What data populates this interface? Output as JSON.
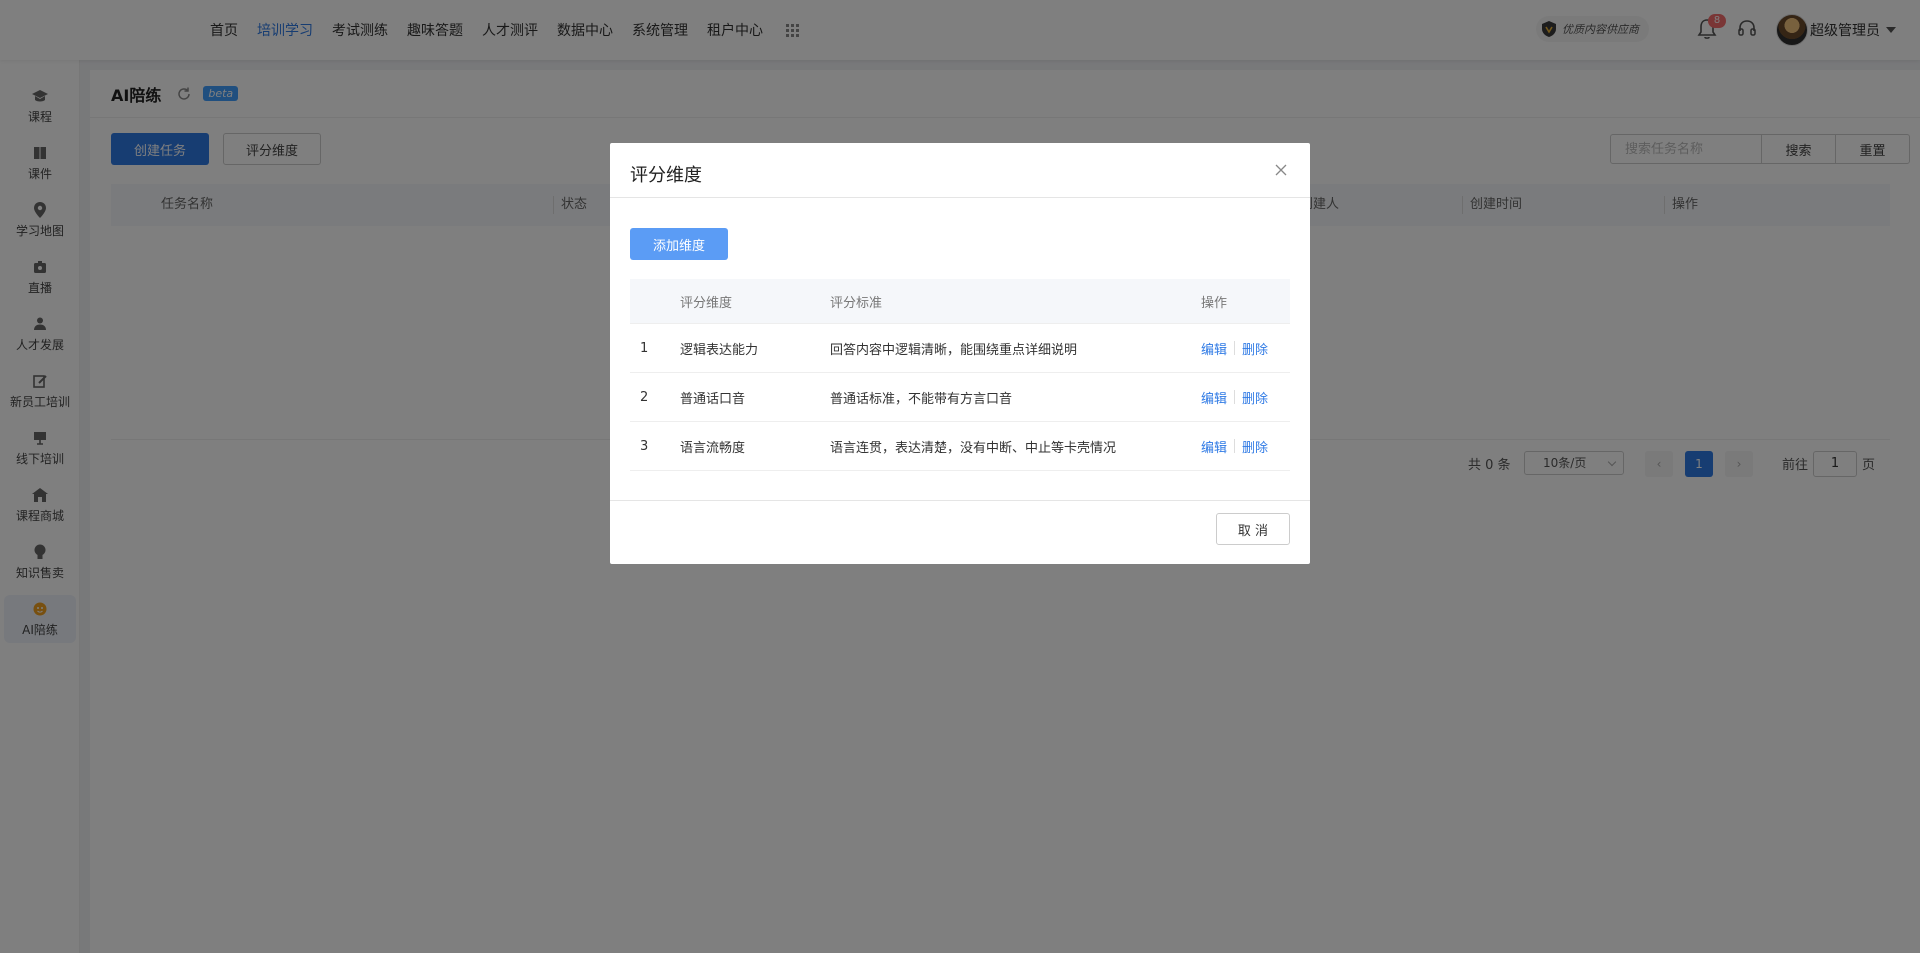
{
  "topnav": {
    "items": [
      {
        "label": "首页",
        "active": false
      },
      {
        "label": "培训学习",
        "active": true
      },
      {
        "label": "考试测练",
        "active": false
      },
      {
        "label": "趣味答题",
        "active": false
      },
      {
        "label": "人才测评",
        "active": false
      },
      {
        "label": "数据中心",
        "active": false
      },
      {
        "label": "系统管理",
        "active": false
      },
      {
        "label": "租户中心",
        "active": false
      }
    ],
    "apps_icon": "grid-icon",
    "vendor_badge": "优质内容供应商",
    "notification_count": "8",
    "user_name": "超级管理员"
  },
  "sidebar": {
    "items": [
      {
        "label": "课程",
        "icon": "graduation-cap-icon",
        "active": false
      },
      {
        "label": "课件",
        "icon": "book-icon",
        "active": false
      },
      {
        "label": "学习地图",
        "icon": "map-pin-icon",
        "active": false
      },
      {
        "label": "直播",
        "icon": "live-camera-icon",
        "active": false
      },
      {
        "label": "人才发展",
        "icon": "people-icon",
        "active": false
      },
      {
        "label": "新员工培训",
        "icon": "edit-icon",
        "active": false
      },
      {
        "label": "线下培训",
        "icon": "presentation-icon",
        "active": false
      },
      {
        "label": "课程商城",
        "icon": "store-icon",
        "active": false
      },
      {
        "label": "知识售卖",
        "icon": "lightbulb-icon",
        "active": false
      },
      {
        "label": "AI陪练",
        "icon": "ai-coach-icon",
        "active": true
      }
    ]
  },
  "page": {
    "title": "AI陪练",
    "beta": "beta",
    "create_task": "创建任务",
    "scoring_dimension": "评分维度",
    "search_placeholder": "搜索任务名称",
    "search": "搜索",
    "reset": "重置",
    "columns": [
      "任务名称",
      "状态",
      "创建人",
      "创建时间",
      "操作"
    ],
    "pagination": {
      "total": "共 0 条",
      "page_size": "10条/页",
      "current_page": "1",
      "goto_prefix": "前往",
      "goto_value": "1",
      "goto_suffix": "页"
    }
  },
  "modal": {
    "title": "评分维度",
    "add_button": "添加维度",
    "columns": {
      "name": "评分维度",
      "standard": "评分标准",
      "action": "操作"
    },
    "rows": [
      {
        "index": "1",
        "name": "逻辑表达能力",
        "standard": "回答内容中逻辑清晰，能围绕重点详细说明",
        "edit": "编辑",
        "delete": "删除"
      },
      {
        "index": "2",
        "name": "普通话口音",
        "standard": "普通话标准，不能带有方言口音",
        "edit": "编辑",
        "delete": "删除"
      },
      {
        "index": "3",
        "name": "语言流畅度",
        "standard": "语言连贯，表达清楚，没有中断、中止等卡壳情况",
        "edit": "编辑",
        "delete": "删除"
      }
    ],
    "cancel": "取 消"
  }
}
